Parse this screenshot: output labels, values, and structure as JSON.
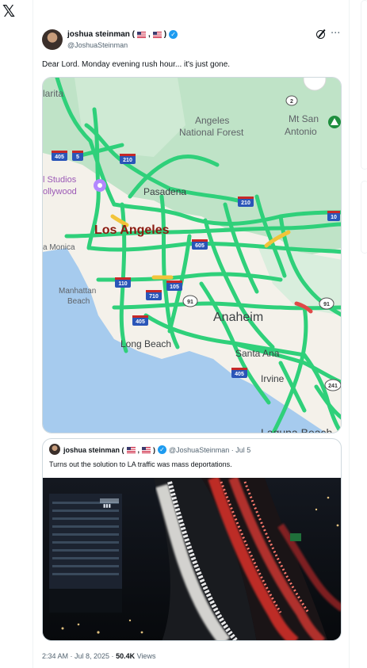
{
  "app": {
    "logo": "𝕏",
    "logo_icon": "x-logo-icon"
  },
  "tweet": {
    "author_name": "joshua steinman (",
    "author_name_end": ")",
    "flag_sep": ",",
    "handle": "@JoshuaSteinman",
    "text": "Dear Lord. Monday evening rush hour... it's just gone.",
    "icons": [
      "grok-icon",
      "more-icon"
    ],
    "more_glyph": "···",
    "verified_glyph": "✓",
    "timestamp": "2:34 AM · Jul 8, 2025 · ",
    "views_count": "50.4K",
    "views_label": " Views"
  },
  "map": {
    "labels": {
      "alarita": "larita",
      "angeles_forest_1": "Angeles",
      "angeles_forest_2": "National Forest",
      "mt_san_1": "Mt San",
      "mt_san_2": "Antonio",
      "studios": "l Studios",
      "hollywood": "ollywood",
      "pasadena": "Pasadena",
      "los_angeles": "Los Angeles",
      "monica": "a Monica",
      "manhattan_1": "Manhattan",
      "manhattan_2": "Beach",
      "anaheim": "Anaheim",
      "long_beach": "Long Beach",
      "santa_ana": "Santa Ana",
      "irvine": "Irvine",
      "laguna": "Laguna Beach"
    },
    "shields": {
      "i405_n": "405",
      "i5": "5",
      "i210_w": "210",
      "i210_e": "210",
      "i10": "10",
      "i605": "605",
      "i110": "110",
      "i105": "105",
      "i710": "710",
      "r91_w": "91",
      "r91_e": "91",
      "i405_s": "405",
      "i405_oc": "405",
      "r2": "2",
      "r241": "241"
    },
    "colors": {
      "traffic_free": "#2fd07a",
      "traffic_slow": "#f2c43a",
      "traffic_heavy": "#e04848",
      "ocean": "#a6cbee",
      "land": "#f4f1ea",
      "park": "#bfe3c7",
      "label": "#5f6368",
      "city_major": "#8b1a10"
    }
  },
  "quote": {
    "author_name": "joshua steinman (",
    "author_name_end": ")",
    "flag_sep": ",",
    "handle_date": "@JoshuaSteinman · Jul 5",
    "text": "Turns out the solution to LA traffic was mass deportations."
  }
}
